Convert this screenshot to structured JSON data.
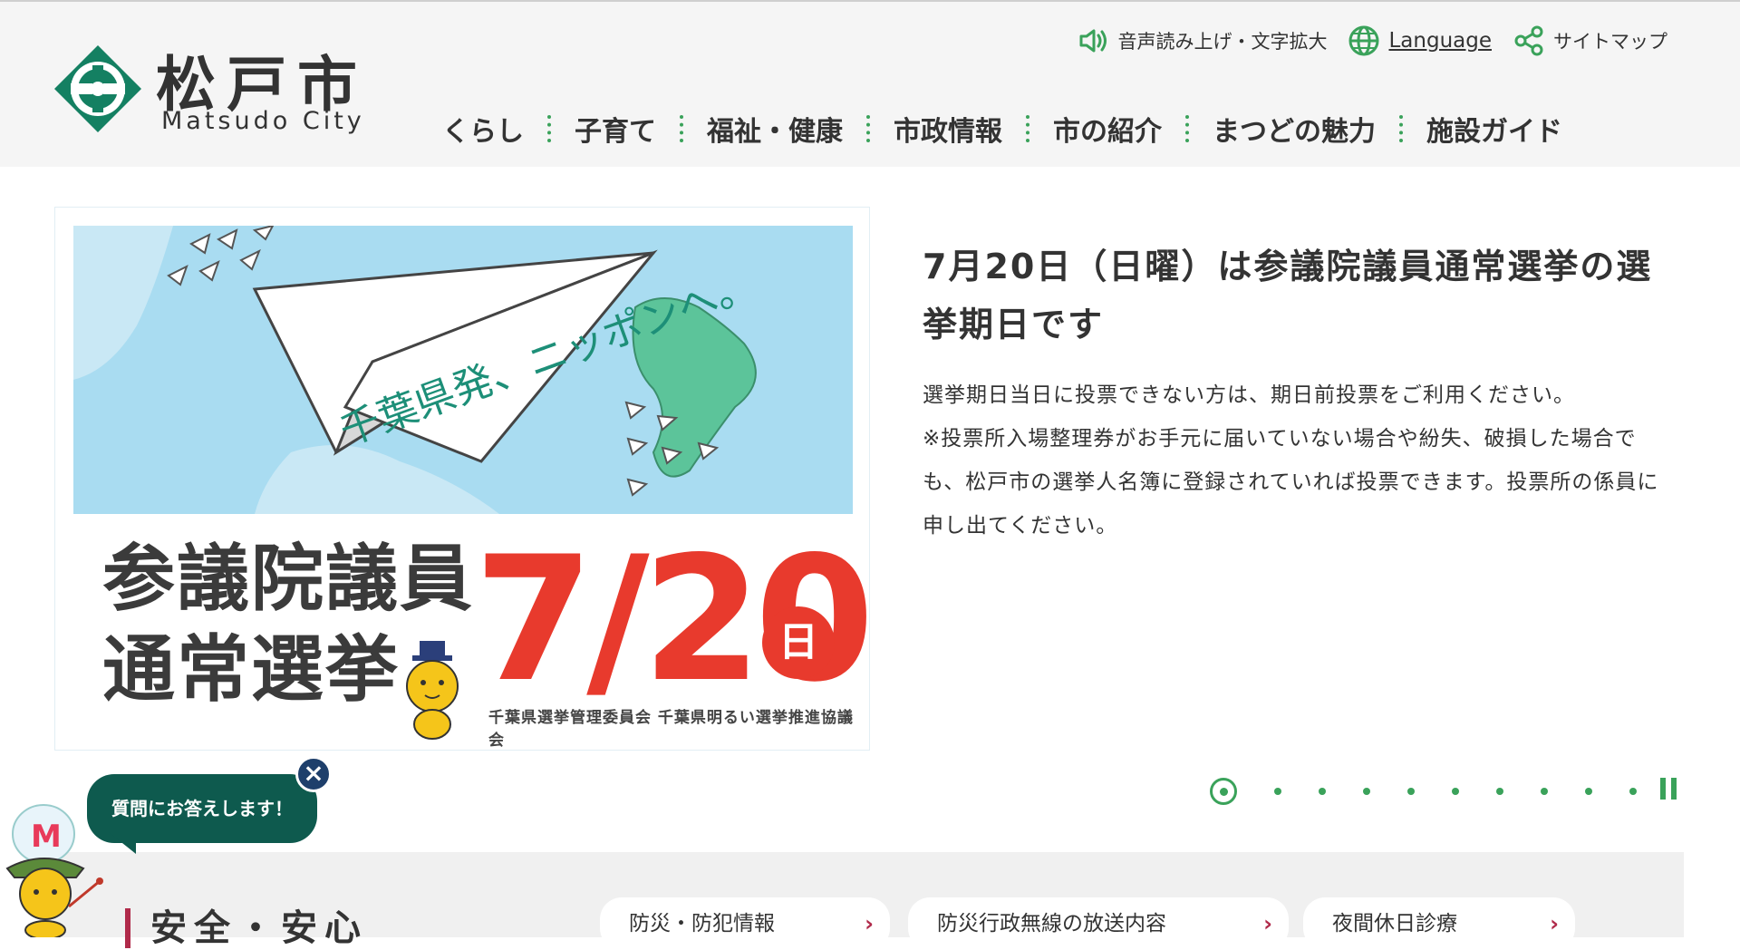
{
  "header": {
    "logo_jp": "松戸市",
    "logo_en": "Matsudo City",
    "utility": {
      "speech_label": "音声読み上げ・文字拡大",
      "language_label": "Language",
      "sitemap_label": "サイトマップ"
    },
    "nav": [
      "くらし",
      "子育て",
      "福祉・健康",
      "市政情報",
      "市の紹介",
      "まつどの魅力",
      "施設ガイド"
    ]
  },
  "banner": {
    "sky_text": "千葉県発、ニッポンへ。",
    "title_line1": "参議院議員",
    "title_line2": "通常選挙",
    "date": "7/20",
    "day": "日",
    "credit": "千葉県選挙管理委員会 千葉県明るい選挙推進協議会"
  },
  "article": {
    "title": "7月20日（日曜）は参議院議員通常選挙の選挙期日です",
    "body_line1": "選挙期日当日に投票できない方は、期日前投票をご利用ください。",
    "body_line2": "※投票所入場整理券がお手元に届いていない場合や紛失、破損した場合でも、松戸市の選挙人名簿に登録されていれば投票できます。投票所の係員に申し出てください。"
  },
  "carousel": {
    "total_slides": 10,
    "active_index": 1
  },
  "chat": {
    "bubble_text": "質問にお答えします！",
    "close_symbol": "×"
  },
  "bottom": {
    "heading": "安全・安心",
    "links": [
      "防災・防犯情報",
      "防災行政無線の放送内容",
      "夜間休日診療"
    ]
  },
  "colors": {
    "accent_green": "#3aa25a",
    "election_red": "#e83a2d",
    "chat_teal": "#0e5a4e",
    "heading_bar": "#b02a4a"
  },
  "icons": [
    "speaker-icon",
    "globe-icon",
    "share-icon",
    "chevron-right-icon",
    "pause-icon",
    "close-icon"
  ]
}
